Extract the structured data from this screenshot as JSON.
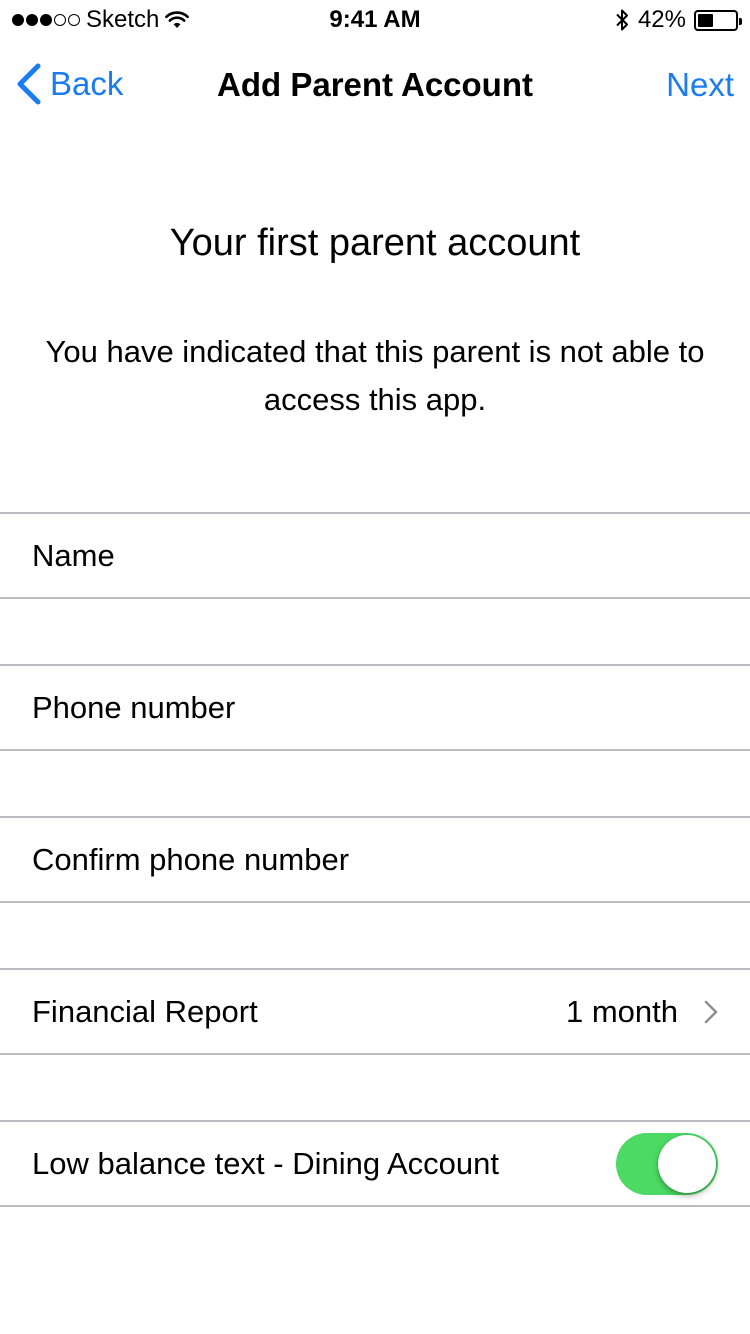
{
  "status_bar": {
    "carrier": "Sketch",
    "time": "9:41 AM",
    "battery_percent": "42%",
    "battery_level": 0.42,
    "signal_bars_filled": 3,
    "signal_bars_total": 5
  },
  "nav": {
    "back_label": "Back",
    "title": "Add Parent Account",
    "next_label": "Next"
  },
  "intro": {
    "heading": "Your first parent account",
    "message": "You have indicated that this parent is not able to access this app."
  },
  "form": {
    "name_placeholder": "Name",
    "phone_placeholder": "Phone number",
    "confirm_phone_placeholder": "Confirm phone number",
    "financial_report_label": "Financial Report",
    "financial_report_value": "1 month",
    "low_balance_label": "Low balance text - Dining Account",
    "low_balance_enabled": true
  },
  "colors": {
    "accent": "#1a7cf0",
    "toggle_on": "#4cd964",
    "separator": "#bcbbc1"
  }
}
